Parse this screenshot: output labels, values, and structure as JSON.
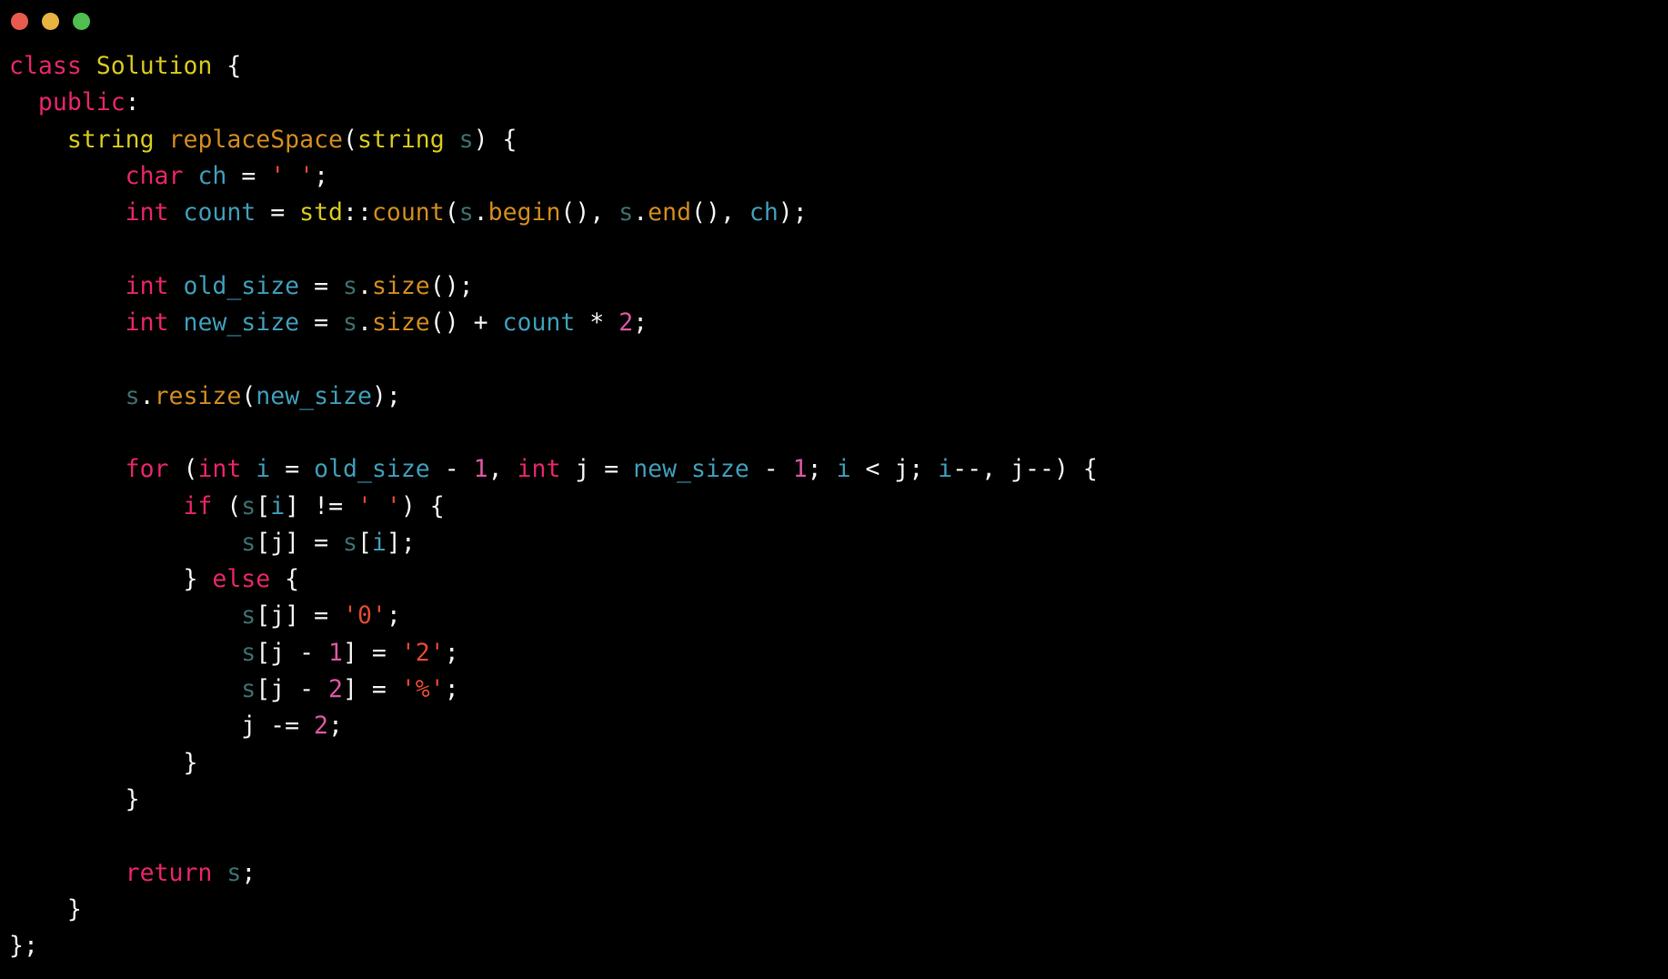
{
  "window": {
    "title": "",
    "background_color": "#000000",
    "traffic_lights": [
      {
        "name": "close",
        "color": "#e85c50",
        "label": "Close"
      },
      {
        "name": "minimize",
        "color": "#e8b341",
        "label": "Minimize"
      },
      {
        "name": "maximize",
        "color": "#4fbf4f",
        "label": "Maximize"
      }
    ]
  },
  "theme": {
    "background": "#000000",
    "foreground": "#f2f2f2",
    "keyword": "#e6256a",
    "type": "#d6c81e",
    "function": "#d08b1e",
    "variable": "#3f9cb8",
    "object": "#3b6e6e",
    "number": "#d957a0",
    "string": "#e04a2f"
  },
  "editor": {
    "language": "cpp",
    "font_size_px": 26.5,
    "line_height_px": 40.3,
    "code_plain": "class Solution {\n  public:\n    string replaceSpace(string s) {\n        char ch = ' ';\n        int count = std::count(s.begin(), s.end(), ch);\n\n        int old_size = s.size();\n        int new_size = s.size() + count * 2;\n\n        s.resize(new_size);\n\n        for (int i = old_size - 1, int j = new_size - 1; i < j; i--, j--) {\n            if (s[i] != ' ') {\n                s[j] = s[i];\n            } else {\n                s[j] = '0';\n                s[j - 1] = '2';\n                s[j - 2] = '%';\n                j -= 2;\n            }\n        }\n\n        return s;\n    }\n};",
    "lines": [
      {
        "n": 1,
        "text": "class Solution {"
      },
      {
        "n": 2,
        "text": "  public:"
      },
      {
        "n": 3,
        "text": "    string replaceSpace(string s) {"
      },
      {
        "n": 4,
        "text": "        char ch = ' ';"
      },
      {
        "n": 5,
        "text": "        int count = std::count(s.begin(), s.end(), ch);"
      },
      {
        "n": 6,
        "text": ""
      },
      {
        "n": 7,
        "text": "        int old_size = s.size();"
      },
      {
        "n": 8,
        "text": "        int new_size = s.size() + count * 2;"
      },
      {
        "n": 9,
        "text": ""
      },
      {
        "n": 10,
        "text": "        s.resize(new_size);"
      },
      {
        "n": 11,
        "text": ""
      },
      {
        "n": 12,
        "text": "        for (int i = old_size - 1, int j = new_size - 1; i < j; i--, j--) {"
      },
      {
        "n": 13,
        "text": "            if (s[i] != ' ') {"
      },
      {
        "n": 14,
        "text": "                s[j] = s[i];"
      },
      {
        "n": 15,
        "text": "            } else {"
      },
      {
        "n": 16,
        "text": "                s[j] = '0';"
      },
      {
        "n": 17,
        "text": "                s[j - 1] = '2';"
      },
      {
        "n": 18,
        "text": "                s[j - 2] = '%';"
      },
      {
        "n": 19,
        "text": "                j -= 2;"
      },
      {
        "n": 20,
        "text": "            }"
      },
      {
        "n": 21,
        "text": "        }"
      },
      {
        "n": 22,
        "text": ""
      },
      {
        "n": 23,
        "text": "        return s;"
      },
      {
        "n": 24,
        "text": "    }"
      },
      {
        "n": 25,
        "text": "};"
      }
    ],
    "tokens": {
      "l1": [
        [
          "kw",
          "class"
        ],
        [
          "pn",
          " "
        ],
        [
          "typ",
          "Solution"
        ],
        [
          "pn",
          " {"
        ]
      ],
      "l2": [
        [
          "pn",
          "  "
        ],
        [
          "kw",
          "public"
        ],
        [
          "pn",
          ":"
        ]
      ],
      "l3": [
        [
          "pn",
          "    "
        ],
        [
          "typ",
          "string"
        ],
        [
          "pn",
          " "
        ],
        [
          "fn",
          "replaceSpace"
        ],
        [
          "pn",
          "("
        ],
        [
          "typ",
          "string"
        ],
        [
          "pn",
          " "
        ],
        [
          "obj",
          "s"
        ],
        [
          "pn",
          ") {"
        ]
      ],
      "l4": [
        [
          "pn",
          "        "
        ],
        [
          "kw",
          "char"
        ],
        [
          "pn",
          " "
        ],
        [
          "var",
          "ch"
        ],
        [
          "pn",
          " = "
        ],
        [
          "str",
          "' '"
        ],
        [
          "pn",
          ";"
        ]
      ],
      "l5": [
        [
          "pn",
          "        "
        ],
        [
          "kw",
          "int"
        ],
        [
          "pn",
          " "
        ],
        [
          "var",
          "count"
        ],
        [
          "pn",
          " = "
        ],
        [
          "typ",
          "std"
        ],
        [
          "pn",
          "::"
        ],
        [
          "fn",
          "count"
        ],
        [
          "pn",
          "("
        ],
        [
          "obj",
          "s"
        ],
        [
          "pn",
          "."
        ],
        [
          "fn",
          "begin"
        ],
        [
          "pn",
          "(), "
        ],
        [
          "obj",
          "s"
        ],
        [
          "pn",
          "."
        ],
        [
          "fn",
          "end"
        ],
        [
          "pn",
          "(), "
        ],
        [
          "var",
          "ch"
        ],
        [
          "pn",
          ");"
        ]
      ],
      "l7": [
        [
          "pn",
          "        "
        ],
        [
          "kw",
          "int"
        ],
        [
          "pn",
          " "
        ],
        [
          "var",
          "old_size"
        ],
        [
          "pn",
          " = "
        ],
        [
          "obj",
          "s"
        ],
        [
          "pn",
          "."
        ],
        [
          "fn",
          "size"
        ],
        [
          "pn",
          "();"
        ]
      ],
      "l8": [
        [
          "pn",
          "        "
        ],
        [
          "kw",
          "int"
        ],
        [
          "pn",
          " "
        ],
        [
          "var",
          "new_size"
        ],
        [
          "pn",
          " = "
        ],
        [
          "obj",
          "s"
        ],
        [
          "pn",
          "."
        ],
        [
          "fn",
          "size"
        ],
        [
          "pn",
          "() + "
        ],
        [
          "var",
          "count"
        ],
        [
          "pn",
          " * "
        ],
        [
          "num",
          "2"
        ],
        [
          "pn",
          ";"
        ]
      ],
      "l10": [
        [
          "pn",
          "        "
        ],
        [
          "obj",
          "s"
        ],
        [
          "pn",
          "."
        ],
        [
          "fn",
          "resize"
        ],
        [
          "pn",
          "("
        ],
        [
          "var",
          "new_size"
        ],
        [
          "pn",
          ");"
        ]
      ],
      "l12": [
        [
          "pn",
          "        "
        ],
        [
          "kw",
          "for"
        ],
        [
          "pn",
          " ("
        ],
        [
          "kw",
          "int"
        ],
        [
          "pn",
          " "
        ],
        [
          "var",
          "i"
        ],
        [
          "pn",
          " = "
        ],
        [
          "var",
          "old_size"
        ],
        [
          "pn",
          " - "
        ],
        [
          "num",
          "1"
        ],
        [
          "pn",
          ", "
        ],
        [
          "kw",
          "int"
        ],
        [
          "pn",
          " j = "
        ],
        [
          "var",
          "new_size"
        ],
        [
          "pn",
          " - "
        ],
        [
          "num",
          "1"
        ],
        [
          "pn",
          "; "
        ],
        [
          "var",
          "i"
        ],
        [
          "pn",
          " < j; "
        ],
        [
          "var",
          "i"
        ],
        [
          "pn",
          "--, j--) {"
        ]
      ],
      "l13": [
        [
          "pn",
          "            "
        ],
        [
          "kw",
          "if"
        ],
        [
          "pn",
          " ("
        ],
        [
          "obj",
          "s"
        ],
        [
          "pn",
          "["
        ],
        [
          "var",
          "i"
        ],
        [
          "pn",
          "] != "
        ],
        [
          "str",
          "' '"
        ],
        [
          "pn",
          ") {"
        ]
      ],
      "l14": [
        [
          "pn",
          "                "
        ],
        [
          "obj",
          "s"
        ],
        [
          "pn",
          "[j] = "
        ],
        [
          "obj",
          "s"
        ],
        [
          "pn",
          "["
        ],
        [
          "var",
          "i"
        ],
        [
          "pn",
          "];"
        ]
      ],
      "l15": [
        [
          "pn",
          "            } "
        ],
        [
          "kw",
          "else"
        ],
        [
          "pn",
          " {"
        ]
      ],
      "l16": [
        [
          "pn",
          "                "
        ],
        [
          "obj",
          "s"
        ],
        [
          "pn",
          "[j] = "
        ],
        [
          "str",
          "'0'"
        ],
        [
          "pn",
          ";"
        ]
      ],
      "l17": [
        [
          "pn",
          "                "
        ],
        [
          "obj",
          "s"
        ],
        [
          "pn",
          "[j - "
        ],
        [
          "num",
          "1"
        ],
        [
          "pn",
          "] = "
        ],
        [
          "str",
          "'2'"
        ],
        [
          "pn",
          ";"
        ]
      ],
      "l18": [
        [
          "pn",
          "                "
        ],
        [
          "obj",
          "s"
        ],
        [
          "pn",
          "[j - "
        ],
        [
          "num",
          "2"
        ],
        [
          "pn",
          "] = "
        ],
        [
          "str",
          "'%'"
        ],
        [
          "pn",
          ";"
        ]
      ],
      "l19": [
        [
          "pn",
          "                j -= "
        ],
        [
          "num",
          "2"
        ],
        [
          "pn",
          ";"
        ]
      ],
      "l20": [
        [
          "pn",
          "            }"
        ]
      ],
      "l21": [
        [
          "pn",
          "        }"
        ]
      ],
      "l23": [
        [
          "pn",
          "        "
        ],
        [
          "kw",
          "return"
        ],
        [
          "pn",
          " "
        ],
        [
          "obj",
          "s"
        ],
        [
          "pn",
          ";"
        ]
      ],
      "l24": [
        [
          "pn",
          "    }"
        ]
      ],
      "l25": [
        [
          "pn",
          "};"
        ]
      ]
    }
  }
}
